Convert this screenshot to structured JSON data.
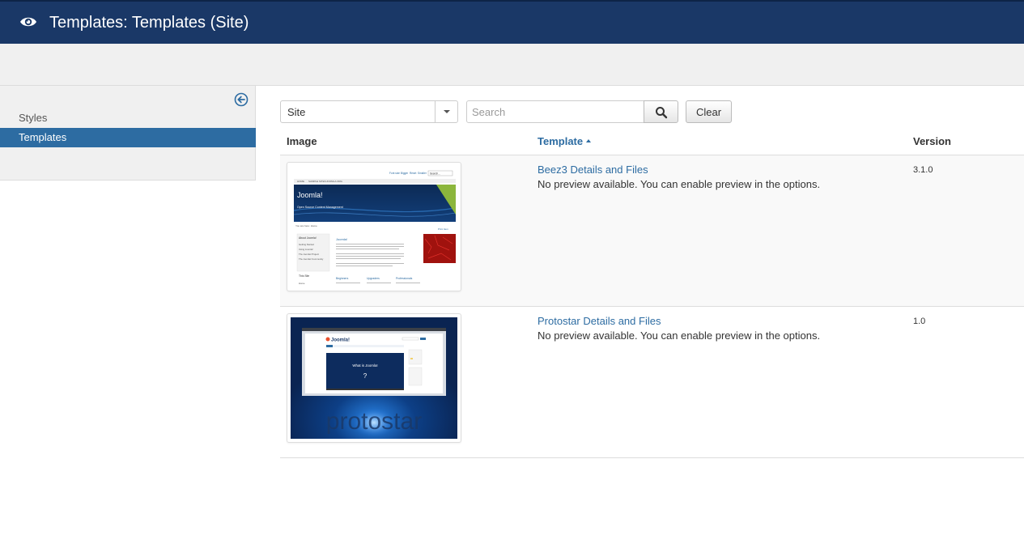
{
  "header": {
    "title": "Templates: Templates (Site)",
    "icon": "eye-icon"
  },
  "sidebar": {
    "toggle_icon": "arrow-circle-left-icon",
    "items": [
      {
        "label": "Styles",
        "active": false
      },
      {
        "label": "Templates",
        "active": true
      }
    ]
  },
  "filters": {
    "client_select": "Site",
    "search_placeholder": "Search",
    "search_icon": "search-icon",
    "clear_label": "Clear"
  },
  "table": {
    "columns": {
      "image": "Image",
      "template": "Template",
      "version": "Version"
    },
    "sort": {
      "column": "template",
      "direction": "asc"
    },
    "rows": [
      {
        "link": "Beez3 Details and Files",
        "description": "No preview available. You can enable preview in the options.",
        "version": "3.1.0",
        "thumb": {
          "nav": [
            "HOME",
            "SAMPLE SITES",
            "JOOMLA.ORG"
          ],
          "top_links": [
            "Font size",
            "Bigger",
            "Reset",
            "Smaller",
            "Search..."
          ],
          "brand": "Joomla!",
          "tagline": "Open Source Content Management",
          "breadcrumb": "You are here: Home",
          "side_heading": "About Joomla!",
          "side_links": [
            "Getting Started",
            "Using Joomla!",
            "The Joomla! Project",
            "The Joomla! Community"
          ],
          "article_title": "Joomla!",
          "side_heading2": "This Site",
          "side_link2": "Home",
          "col_heads": [
            "Beginners",
            "Upgraders",
            "Professionals"
          ],
          "print_link": "Print Item"
        }
      },
      {
        "link": "Protostar Details and Files",
        "description": "No preview available. You can enable preview in the options.",
        "version": "1.0",
        "thumb": {
          "logo": "Joomla!",
          "video_text": "What is Joomla!",
          "question": "?",
          "brand": "protostar"
        }
      }
    ]
  },
  "colors": {
    "header_bg": "#1a3867",
    "accent": "#2d6ca2",
    "toolbar_bg": "#f0f0f0"
  }
}
